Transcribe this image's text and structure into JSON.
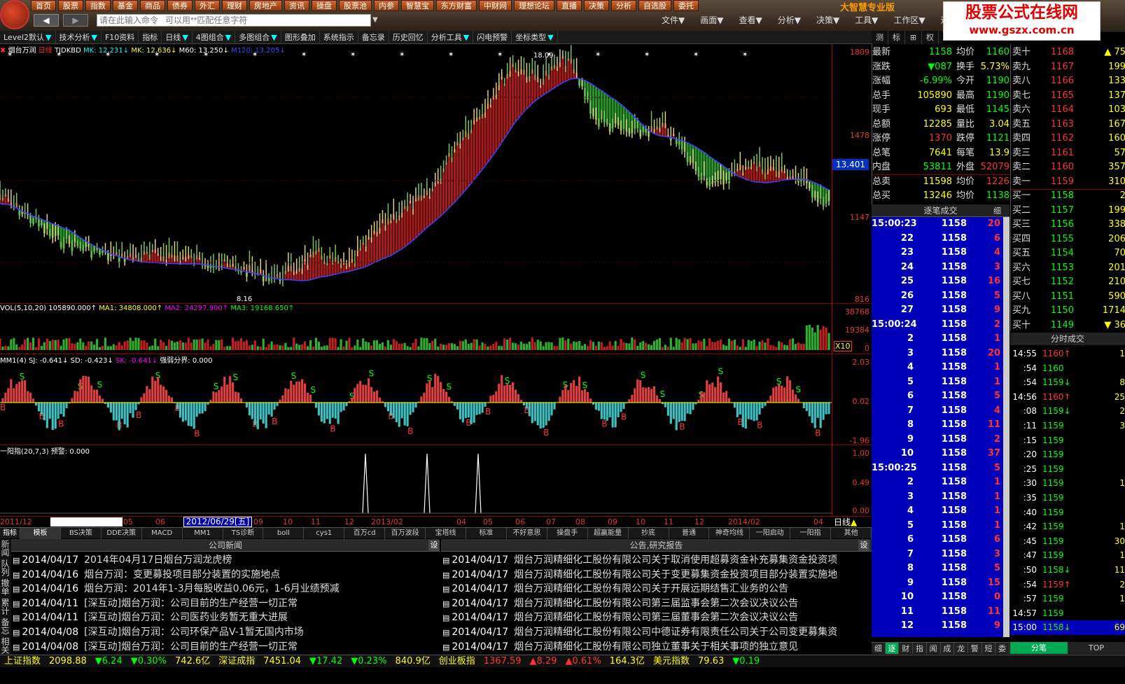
{
  "topbar": {
    "nav": [
      "首页",
      "股票",
      "指数",
      "基金",
      "商品",
      "债券",
      "外汇",
      "理财",
      "房地产",
      "资讯",
      "操盘",
      "股票池",
      "内参",
      "智慧宝",
      "东方财富",
      "中财网",
      "理想论坛",
      "直播",
      "决策",
      "分析",
      "自选股",
      "委托"
    ],
    "back": "◀",
    "forward": "▶",
    "cmd_placeholder": "请在此输入命令   可以用**匹配任意字符",
    "brand": "大智慧专业版",
    "menu": [
      "文件▼",
      "画面▼",
      "查看▼",
      "分析▼",
      "决策▼",
      "工具▼",
      "工作区▼",
      "退"
    ],
    "banner_title": "股票公式在线网",
    "banner_url": "www.gszx.com.cn"
  },
  "toolbar": [
    {
      "label": "Level2默认",
      "ar": "▼"
    },
    {
      "label": "技术分析",
      "ar": "▼"
    },
    {
      "label": "F10资料",
      "ar": ""
    },
    {
      "label": "指标",
      "ar": ""
    },
    {
      "label": "日线",
      "ar": "▼"
    },
    {
      "label": "4图组合",
      "ar": "▼"
    },
    {
      "label": "多图组合",
      "ar": "▼"
    },
    {
      "label": "图形叠加",
      "ar": ""
    },
    {
      "label": "系统指示",
      "ar": ""
    },
    {
      "label": "备忘录",
      "ar": ""
    },
    {
      "label": "历史回忆",
      "ar": ""
    },
    {
      "label": "分析工具",
      "ar": "▼"
    },
    {
      "label": "闪电预警",
      "ar": ""
    },
    {
      "label": "坐标类型",
      "ar": "▼"
    }
  ],
  "rtabs": [
    "测",
    "标",
    "⊞",
    "权"
  ],
  "chart": {
    "title": {
      "name": "烟台万润",
      "period": "日线",
      "ind": "TJDKBD",
      "mk": "MK: 12.231↓",
      "mk2": "MK: 12.636↓",
      "m60": "M60: 13.250↓",
      "m120": "M120: 13.205↓"
    },
    "price_axis": [
      "1809",
      "1478",
      "1147",
      "816"
    ],
    "current_price": "13.401",
    "high_label": "18.09",
    "low_label": "8.16",
    "vol_title": {
      "a": "VOL(5,10,20)",
      "b": "105890.000↑",
      "c": "MA1: 34808.000↑",
      "d": "MA2: 24297.900↑",
      "e": "MA3: 19168.650↑"
    },
    "vol_axis": [
      "38768",
      "19384",
      "0"
    ],
    "vol_unit": "X10",
    "mm_title": {
      "a": "MM1(4)",
      "b": "SJ: -0.641↓",
      "c": "SD: -0.423↓",
      "d": "SK: -0.641↓",
      "e": "强弱分界: 0.000"
    },
    "mm_axis": [
      "2.03",
      "0.02",
      "-1.96"
    ],
    "yy_title": {
      "a": "一阳指(20,7,3)",
      "b": "预警: 0.000"
    },
    "yy_axis": [
      "1.00",
      "0.49",
      "0.00"
    ]
  },
  "datebar": {
    "labels": [
      "2011/12",
      "05",
      "06",
      "09",
      "10",
      "11",
      "12",
      "2013/02",
      "04",
      "05",
      "06",
      "07",
      "08",
      "09",
      "10",
      "11",
      "12",
      "2014/02",
      "04"
    ],
    "current": "2012/06/29[五]",
    "cycle": "日线"
  },
  "indtabs": [
    "指标",
    "模板",
    "BS决策",
    "DDE决策",
    "MACD",
    "MM1",
    "TS诊断",
    "boll",
    "cys1",
    "百万cd",
    "百万波段",
    "宝塔线",
    "标准",
    "不好意思",
    "操盘手",
    "超赢能量",
    "抄底",
    "普通",
    "神奇均线",
    "一阳启动",
    "一阳指",
    "其他"
  ],
  "news": {
    "side": "新闻 队列 撤单 累计 备忘 相关",
    "head_left": "公司新闻",
    "head_right": "公告,研究报告",
    "set": "设",
    "left": [
      {
        "d": "2014/04/17",
        "t": "2014年04月17日烟台万润龙虎榜"
      },
      {
        "d": "2014/04/16",
        "t": "烟台万润：变更募投项目部分装置的实施地点"
      },
      {
        "d": "2014/04/16",
        "t": "烟台万润：2014年1-3月每股收益0.06元，1-6月业绩预减"
      },
      {
        "d": "2014/04/11",
        "t": "[深互动]烟台万润：公司目前的生产经营一切正常"
      },
      {
        "d": "2014/04/11",
        "t": "[深互动]烟台万润：公司医药业务暂无重大进展"
      },
      {
        "d": "2014/04/08",
        "t": "[深互动]烟台万润：公司环保产品V-1暂无国内市场"
      },
      {
        "d": "2014/04/08",
        "t": "[深互动]烟台万润：公司目前的生产经营一切正常"
      }
    ],
    "right": [
      {
        "d": "2014/04/17",
        "t": "烟台万润精细化工股份有限公司关于取消使用超募资金补充募集资金投资项"
      },
      {
        "d": "2014/04/17",
        "t": "烟台万润精细化工股份有限公司关于变更募集资金投资项目部分装置实施地"
      },
      {
        "d": "2014/04/17",
        "t": "烟台万润精细化工股份有限公司关于开展远期结售汇业务的公告"
      },
      {
        "d": "2014/04/17",
        "t": "烟台万润精细化工股份有限公司第三届监事会第二次会议决议公告"
      },
      {
        "d": "2014/04/17",
        "t": "烟台万润精细化工股份有限公司第三届董事会第二次会议决议公告"
      },
      {
        "d": "2014/04/17",
        "t": "烟台万润精细化工股份有限公司中德证券有限责任公司关于公司变更募集资"
      },
      {
        "d": "2014/04/17",
        "t": "烟台万润精细化工股份有限公司独立董事关于相关事项的独立意见"
      }
    ]
  },
  "status": [
    {
      "t": "上证指数",
      "c": "yel"
    },
    {
      "t": "2098.88",
      "c": "yel"
    },
    {
      "t": "▼6.24",
      "c": "dn"
    },
    {
      "t": "▼0.30%",
      "c": "dn"
    },
    {
      "t": "742.6亿",
      "c": "yel"
    },
    {
      "t": "深证成指",
      "c": "yel"
    },
    {
      "t": "7451.04",
      "c": "yel"
    },
    {
      "t": "▼17.42",
      "c": "dn"
    },
    {
      "t": "▼0.23%",
      "c": "dn"
    },
    {
      "t": "840.9亿",
      "c": "yel"
    },
    {
      "t": "创业板指",
      "c": "yel"
    },
    {
      "t": "1367.59",
      "c": "up"
    },
    {
      "t": "▲8.29",
      "c": "up"
    },
    {
      "t": "▲0.61%",
      "c": "up"
    },
    {
      "t": "164.3亿",
      "c": "yel"
    },
    {
      "t": "美元指数",
      "c": "yel"
    },
    {
      "t": "79.63",
      "c": "yel"
    },
    {
      "t": "▼0.19",
      "c": "dn"
    }
  ],
  "quote": [
    {
      "l": "最新",
      "v": "1158",
      "vc": "dn",
      "l2": "均价",
      "v2": "1160",
      "v2c": "dn"
    },
    {
      "l": "涨跌",
      "v": "▼087",
      "vc": "dn",
      "l2": "换手",
      "v2": "5.73%",
      "v2c": "yel"
    },
    {
      "l": "涨幅",
      "v": "-6.99%",
      "vc": "dn",
      "l2": "今开",
      "v2": "1190",
      "v2c": "dn"
    },
    {
      "l": "总手",
      "v": "105890",
      "vc": "yel",
      "l2": "最高",
      "v2": "1190",
      "v2c": "dn"
    },
    {
      "l": "现手",
      "v": "693",
      "vc": "yel",
      "l2": "最低",
      "v2": "1145",
      "v2c": "dn"
    },
    {
      "l": "总额",
      "v": "12285",
      "vc": "yel",
      "l2": "量比",
      "v2": "3.04",
      "v2c": "yel"
    },
    {
      "l": "涨停",
      "v": "1370",
      "vc": "up",
      "l2": "跌停",
      "v2": "1121",
      "v2c": "dn"
    },
    {
      "l": "总笔",
      "v": "7641",
      "vc": "yel",
      "l2": "每笔",
      "v2": "13.9",
      "v2c": "yel"
    },
    {
      "l": "内盘",
      "v": "53811",
      "vc": "dn",
      "l2": "外盘",
      "v2": "52079",
      "v2c": "up"
    },
    {
      "l": "总卖",
      "v": "11598",
      "vc": "yel",
      "l2": "均价",
      "v2": "1226",
      "v2c": "up"
    },
    {
      "l": "总买",
      "v": "13246",
      "vc": "yel",
      "l2": "均价",
      "v2": "1138",
      "v2c": "dn"
    }
  ],
  "ticks_head": "逐笔成交",
  "ticks_btn": "细",
  "ticks": [
    {
      "t": "15:00:23",
      "p": "1158",
      "v": "20"
    },
    {
      "t": "22",
      "p": "1158",
      "v": "6"
    },
    {
      "t": "23",
      "p": "1158",
      "v": "4"
    },
    {
      "t": "24",
      "p": "1158",
      "v": "3"
    },
    {
      "t": "25",
      "p": "1158",
      "v": "16"
    },
    {
      "t": "26",
      "p": "1158",
      "v": "5"
    },
    {
      "t": "27",
      "p": "1158",
      "v": "9"
    },
    {
      "t": "15:00:24",
      "p": "1158",
      "v": "2"
    },
    {
      "t": "2",
      "p": "1158",
      "v": "1"
    },
    {
      "t": "3",
      "p": "1158",
      "v": "20"
    },
    {
      "t": "4",
      "p": "1158",
      "v": "1"
    },
    {
      "t": "5",
      "p": "1158",
      "v": "1"
    },
    {
      "t": "6",
      "p": "1158",
      "v": "5"
    },
    {
      "t": "7",
      "p": "1158",
      "v": "4"
    },
    {
      "t": "8",
      "p": "1158",
      "v": "11"
    },
    {
      "t": "9",
      "p": "1158",
      "v": "2"
    },
    {
      "t": "10",
      "p": "1158",
      "v": "37"
    },
    {
      "t": "15:00:25",
      "p": "1158",
      "v": "5"
    },
    {
      "t": "2",
      "p": "1158",
      "v": "1"
    },
    {
      "t": "3",
      "p": "1158",
      "v": "1"
    },
    {
      "t": "4",
      "p": "1158",
      "v": "1"
    },
    {
      "t": "5",
      "p": "1158",
      "v": "1"
    },
    {
      "t": "6",
      "p": "1158",
      "v": "6"
    },
    {
      "t": "7",
      "p": "1158",
      "v": "3"
    },
    {
      "t": "8",
      "p": "1158",
      "v": "5"
    },
    {
      "t": "9",
      "p": "1158",
      "v": "15"
    },
    {
      "t": "10",
      "p": "1158",
      "v": "0"
    },
    {
      "t": "11",
      "p": "1158",
      "v": "11"
    },
    {
      "t": "12",
      "p": "1158",
      "v": "9"
    }
  ],
  "rbot": [
    "细",
    "逐",
    "财",
    "指",
    "闻",
    "成",
    "龙",
    "警",
    "短",
    "委"
  ],
  "book": [
    {
      "l": "卖十",
      "p": "1168",
      "pc": "up",
      "v": "▲ 75"
    },
    {
      "l": "卖九",
      "p": "1167",
      "pc": "up",
      "v": "199"
    },
    {
      "l": "卖八",
      "p": "1166",
      "pc": "up",
      "v": "133"
    },
    {
      "l": "卖七",
      "p": "1165",
      "pc": "up",
      "v": "137"
    },
    {
      "l": "卖六",
      "p": "1164",
      "pc": "up",
      "v": "103"
    },
    {
      "l": "卖五",
      "p": "1163",
      "pc": "up",
      "v": "167"
    },
    {
      "l": "卖四",
      "p": "1162",
      "pc": "up",
      "v": "160"
    },
    {
      "l": "卖三",
      "p": "1161",
      "pc": "up",
      "v": "57"
    },
    {
      "l": "卖二",
      "p": "1160",
      "pc": "up",
      "v": "357"
    },
    {
      "l": "卖一",
      "p": "1159",
      "pc": "up",
      "v": "310"
    },
    {
      "l": "买一",
      "p": "1158",
      "pc": "dn",
      "v": "2"
    },
    {
      "l": "买二",
      "p": "1157",
      "pc": "dn",
      "v": "199"
    },
    {
      "l": "买三",
      "p": "1156",
      "pc": "dn",
      "v": "338"
    },
    {
      "l": "买四",
      "p": "1155",
      "pc": "dn",
      "v": "206"
    },
    {
      "l": "买五",
      "p": "1154",
      "pc": "dn",
      "v": "70"
    },
    {
      "l": "买六",
      "p": "1153",
      "pc": "dn",
      "v": "201"
    },
    {
      "l": "买七",
      "p": "1152",
      "pc": "dn",
      "v": "210"
    },
    {
      "l": "买八",
      "p": "1151",
      "pc": "dn",
      "v": "590"
    },
    {
      "l": "买九",
      "p": "1150",
      "pc": "dn",
      "v": "1714"
    },
    {
      "l": "买十",
      "p": "1149",
      "pc": "dn",
      "v": "▼ 36"
    }
  ],
  "fen_head": "分时成交",
  "fen": [
    {
      "t": "14:55",
      "p": "1160↑",
      "pc": "up",
      "v": "1"
    },
    {
      "t": ":54",
      "p": "1160",
      "pc": "dn",
      "v": ""
    },
    {
      "t": ":54",
      "p": "1159↓",
      "pc": "dn",
      "v": "8"
    },
    {
      "t": "14:56",
      "p": "1160↑",
      "pc": "up",
      "v": "25"
    },
    {
      "t": ":08",
      "p": "1159↓",
      "pc": "dn",
      "v": "2"
    },
    {
      "t": ":11",
      "p": "1159",
      "pc": "dn",
      "v": "3"
    },
    {
      "t": ":15",
      "p": "1159",
      "pc": "dn",
      "v": ""
    },
    {
      "t": ":20",
      "p": "1159",
      "pc": "dn",
      "v": ""
    },
    {
      "t": ":25",
      "p": "1159",
      "pc": "dn",
      "v": ""
    },
    {
      "t": ":30",
      "p": "1159",
      "pc": "dn",
      "v": "1"
    },
    {
      "t": ":35",
      "p": "1159",
      "pc": "dn",
      "v": ""
    },
    {
      "t": ":40",
      "p": "1159",
      "pc": "dn",
      "v": ""
    },
    {
      "t": ":42",
      "p": "1159",
      "pc": "dn",
      "v": "1"
    },
    {
      "t": ":45",
      "p": "1159",
      "pc": "dn",
      "v": "30"
    },
    {
      "t": ":47",
      "p": "1159",
      "pc": "dn",
      "v": "1"
    },
    {
      "t": ":50",
      "p": "1158↓",
      "pc": "dn",
      "v": "11"
    },
    {
      "t": ":54",
      "p": "1159↑",
      "pc": "up",
      "v": "2"
    },
    {
      "t": ":57",
      "p": "1159",
      "pc": "dn",
      "v": "1"
    },
    {
      "t": "14:57",
      "p": "1159",
      "pc": "dn",
      "v": ""
    },
    {
      "t": "15:00",
      "p": "1158↓",
      "pc": "dn",
      "v": "69"
    }
  ],
  "fen_tabs": [
    "分笔",
    "TOP"
  ],
  "colors": {
    "up": "#ff3333",
    "down": "#00ff00",
    "accent": "#ff9900",
    "bg": "#000000"
  }
}
